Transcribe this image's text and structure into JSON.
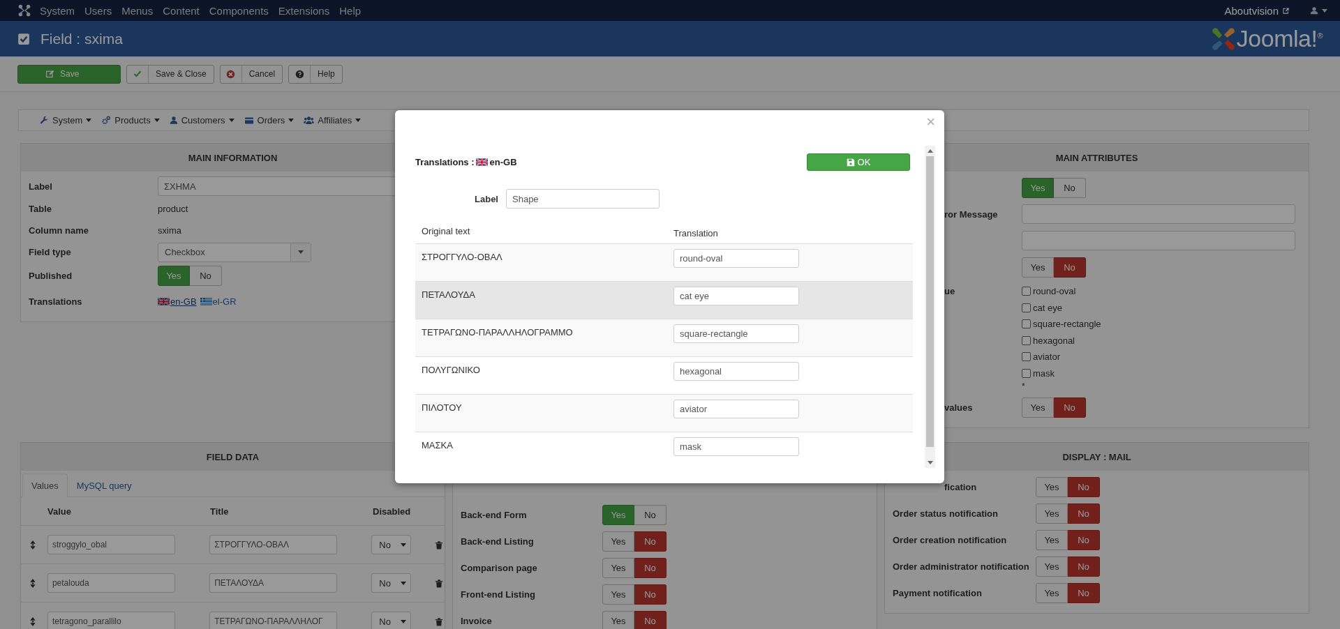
{
  "topbar": {
    "menu": [
      "System",
      "Users",
      "Menus",
      "Content",
      "Components",
      "Extensions",
      "Help"
    ],
    "site_link": "Aboutvision"
  },
  "header": {
    "title": "Field : sxima",
    "logo_text": "Joomla!$^{®}$"
  },
  "toolbar": [
    {
      "label": "Save",
      "kind": "save"
    },
    {
      "label": "Save & Close",
      "kind": "save-close"
    },
    {
      "label": "Cancel",
      "kind": "cancel"
    },
    {
      "label": "Help",
      "kind": "help"
    }
  ],
  "submenu": [
    "System",
    "Products",
    "Customers",
    "Orders",
    "Affiliates"
  ],
  "main_information": {
    "title": "MAIN INFORMATION",
    "rows": [
      {
        "kind": "input",
        "label": "Label",
        "value": "ΣΧΗΜΑ"
      },
      {
        "kind": "text",
        "label": "Table",
        "value": "product"
      },
      {
        "kind": "text",
        "label": "Column name",
        "value": "sxima"
      },
      {
        "kind": "select",
        "label": "Field type",
        "value": "Checkbox"
      },
      {
        "kind": "toggle",
        "label": "Published",
        "on": true,
        "yes": "Yes",
        "no": "No"
      },
      {
        "kind": "links",
        "label": "Translations",
        "links": [
          {
            "label": "en-GB",
            "hovered": true
          },
          {
            "label": "el-GR",
            "hovered": false
          }
        ]
      }
    ]
  },
  "main_attributes": {
    "title": "MAIN ATTRIBUTES",
    "rows": [
      {
        "kind": "toggle",
        "on": true,
        "yes": "Yes",
        "no": "No"
      },
      {
        "kind": "input",
        "label": "ror Message"
      },
      {
        "kind": "input"
      },
      {
        "kind": "toggle",
        "on": false,
        "yes": "Yes",
        "no": "No"
      },
      {
        "kind": "checkboxes",
        "label": "ue",
        "options": [
          {
            "label": "round-oval",
            "checked": false
          },
          {
            "label": "cat eye",
            "checked": false
          },
          {
            "label": "square-rectangle",
            "checked": false
          },
          {
            "label": "hexagonal",
            "checked": false
          },
          {
            "label": "aviator",
            "checked": false
          },
          {
            "label": "mask",
            "checked": false
          }
        ],
        "note": "*"
      },
      {
        "kind": "toggle",
        "label": "values",
        "on": false,
        "yes": "Yes",
        "no": "No"
      }
    ]
  },
  "field_data": {
    "title": "FIELD DATA",
    "tabs": [
      {
        "label": "Values",
        "selected": true
      },
      {
        "label": "MySQL query",
        "selected": false
      }
    ],
    "columns": [
      "Value",
      "Title",
      "Disabled"
    ],
    "rows": [
      {
        "value": "stroggylo_obal",
        "title": "ΣΤΡΟΓΓΥΛΟ-ΟΒΑΛ",
        "disabled": "No"
      },
      {
        "value": "petalouda",
        "title": "ΠΕΤΑΛΟΥΔΑ",
        "disabled": "No"
      },
      {
        "value": "tetragono_parallilo",
        "title": "ΤΕΤΡΑΓΩΝΟ-ΠΑΡΑΛΛΗΛΟΓ",
        "disabled": "No"
      }
    ]
  },
  "display": {
    "rows": [
      {
        "label": "Back-end Form",
        "on": true,
        "yes": "Yes",
        "no": "No"
      },
      {
        "label": "Back-end Listing",
        "on": false,
        "yes": "Yes",
        "no": "No"
      },
      {
        "label": "Comparison page",
        "on": false,
        "yes": "Yes",
        "no": "No"
      },
      {
        "label": "Front-end Listing",
        "on": false,
        "yes": "Yes",
        "no": "No"
      },
      {
        "label": "Invoice",
        "on": false,
        "yes": "Yes",
        "no": "No"
      }
    ]
  },
  "display_mail": {
    "title": "DISPLAY : MAIL",
    "rows": [
      {
        "label": "fication",
        "on": false,
        "yes": "Yes",
        "no": "No"
      },
      {
        "label": "Order status notification",
        "on": false,
        "yes": "Yes",
        "no": "No"
      },
      {
        "label": "Order creation notification",
        "on": false,
        "yes": "Yes",
        "no": "No"
      },
      {
        "label": "Order administrator notification",
        "on": false,
        "yes": "Yes",
        "no": "No"
      },
      {
        "label": "Payment notification",
        "on": false,
        "yes": "Yes",
        "no": "No"
      }
    ]
  },
  "modal": {
    "close": "×",
    "title": "Translations :",
    "language": "en-GB",
    "ok": "OK",
    "label_field": {
      "label": "Label",
      "value": "Shape"
    },
    "columns": [
      "Original text",
      "Translation"
    ],
    "rows": [
      {
        "original": "ΣΤΡΟΓΓΥΛΟ-ΟΒΑΛ",
        "translation": "round-oval",
        "highlighted": false
      },
      {
        "original": "ΠΕΤΑΛΟΥΔΑ",
        "translation": "cat eye",
        "highlighted": true
      },
      {
        "original": "ΤΕΤΡΑΓΩΝΟ-ΠΑΡΑΛΛΗΛΟΓΡΑΜΜΟ",
        "translation": "square-rectangle",
        "highlighted": false
      },
      {
        "original": "ΠΟΛΥΓΩΝΙΚΟ",
        "translation": "hexagonal",
        "highlighted": false
      },
      {
        "original": "ΠΙΛΟΤΟΥ",
        "translation": "aviator",
        "highlighted": false
      },
      {
        "original": "ΜΑΣΚΑ",
        "translation": "mask",
        "highlighted": false
      }
    ]
  }
}
